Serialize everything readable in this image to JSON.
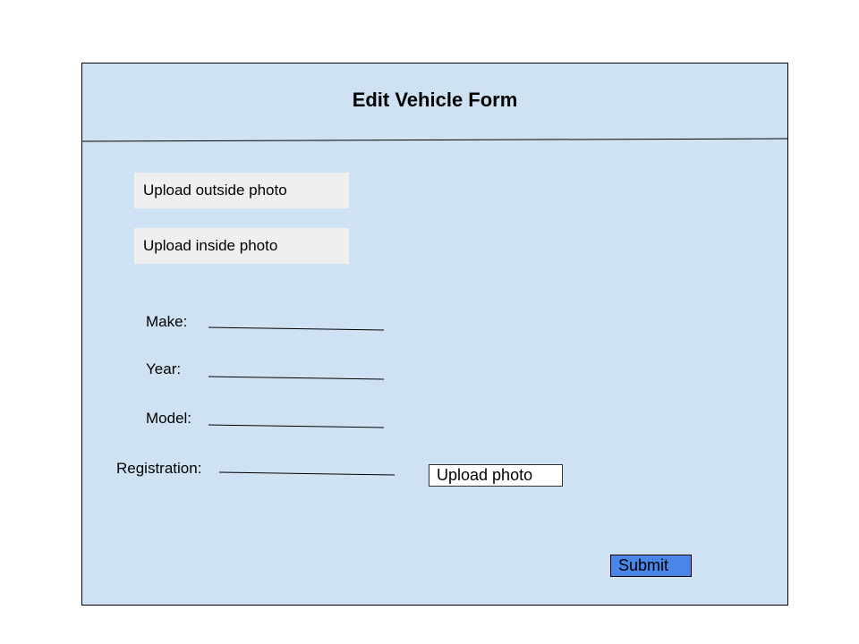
{
  "form": {
    "title": "Edit Vehicle Form",
    "upload_outside_label": "Upload outside photo",
    "upload_inside_label": "Upload inside photo",
    "fields": {
      "make": {
        "label": "Make:",
        "value": ""
      },
      "year": {
        "label": "Year:",
        "value": ""
      },
      "model": {
        "label": "Model:",
        "value": ""
      },
      "registration": {
        "label": "Registration:",
        "value": ""
      }
    },
    "upload_photo_label": "Upload photo",
    "submit_label": "Submit"
  },
  "colors": {
    "panel_background": "#cfe2f3",
    "upload_box_background": "#efefef",
    "submit_background": "#4a86e8"
  }
}
